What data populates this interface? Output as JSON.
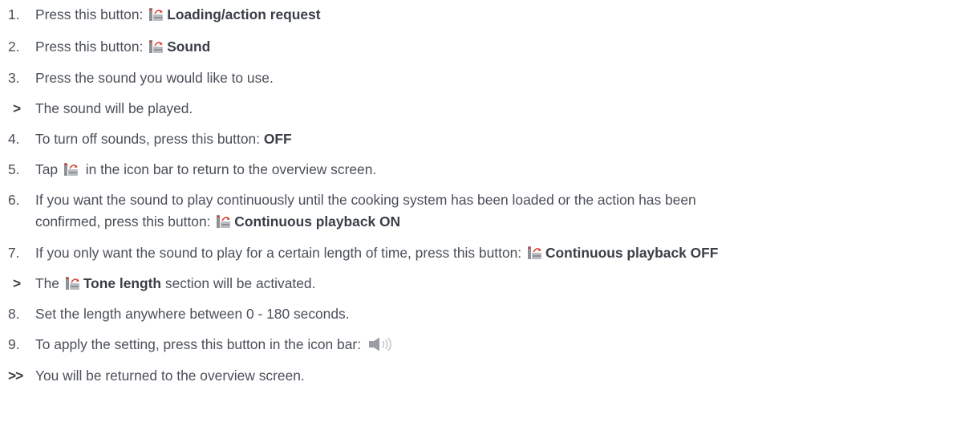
{
  "steps": [
    {
      "marker": "1.",
      "text": "Press this button: ",
      "bold": "Loading/action request",
      "icon": "loading-request-icon"
    },
    {
      "marker": "2.",
      "text": "Press this button: ",
      "bold": "Sound",
      "icon": "sound-settings-icon"
    },
    {
      "marker": "3.",
      "text": "Press the sound you would like to use."
    },
    {
      "marker": ">",
      "text": "The sound will be played."
    },
    {
      "marker": "4.",
      "text": "To turn off sounds, press this button: ",
      "bold": "OFF"
    },
    {
      "marker": "5.",
      "text_before": "Tap ",
      "text_after": " in the icon bar to return to the overview screen.",
      "icon": "back-icon"
    },
    {
      "marker": "6.",
      "line1": "If you want the sound to play continuously until the cooking system has been loaded or the action has been",
      "line2": "confirmed, press this button: ",
      "bold": "Continuous playback ON",
      "icon": "continuous-playback-icon"
    },
    {
      "marker": "7.",
      "text": "If you only want the sound to play for a certain length of time, press this button: ",
      "bold": "Continuous playback OFF",
      "icon": "continuous-playback-icon"
    },
    {
      "marker": ">",
      "text_before": "The ",
      "bold": "Tone length",
      "text_after": " section will be activated.",
      "icon": "tone-length-icon"
    },
    {
      "marker": "8.",
      "text": "Set the length anywhere between 0 - 180 seconds."
    },
    {
      "marker": "9.",
      "text": "To apply the setting, press this button in the icon bar: ",
      "icon": "speaker-icon"
    },
    {
      "marker": ">>",
      "text": "You will be returned to the overview screen."
    }
  ],
  "colors": {
    "text": "#4a4f58",
    "icon_gray": "#9a9da2",
    "icon_red": "#d9412e"
  }
}
